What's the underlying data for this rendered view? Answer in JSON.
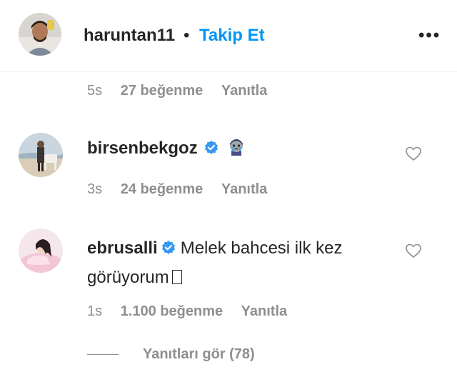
{
  "post_header": {
    "username": "haruntan11",
    "separator": "•",
    "follow_label": "Takip Et",
    "more_icon": "more-horizontal-icon"
  },
  "top_comment_meta": {
    "time": "5s",
    "likes": "27 beğenme",
    "reply_label": "Yanıtla"
  },
  "comments": [
    {
      "username": "birsenbekgoz",
      "verified": true,
      "emoji": "crying-face-emoji",
      "time": "3s",
      "likes": "24 beğenme",
      "reply_label": "Yanıtla"
    },
    {
      "username": "ebrusalli",
      "verified": true,
      "text_line1": "Melek bahcesi ilk kez",
      "text_line2": "görüyorum",
      "time": "1s",
      "likes": "1.100 beğenme",
      "reply_label": "Yanıtla"
    }
  ],
  "view_replies_label": "Yanıtları gör (78)",
  "colors": {
    "link_blue": "#0095f6",
    "verified_blue": "#3897f0",
    "meta_gray": "#8e8e8e",
    "text": "#262626"
  }
}
